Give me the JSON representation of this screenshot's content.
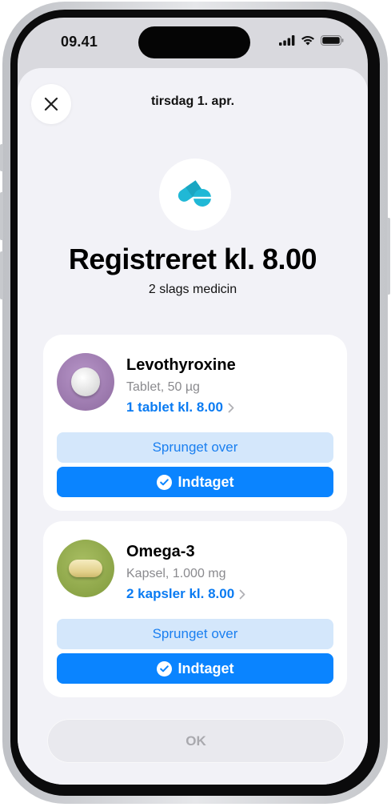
{
  "status_bar": {
    "time": "09.41",
    "icons": [
      "signal-icon",
      "wifi-icon",
      "battery-icon"
    ]
  },
  "sheet": {
    "close_icon": "close-icon",
    "date": "tirsdag 1. apr.",
    "app_icon": "pills-icon",
    "title": "Registreret kl. 8.00",
    "subtitle": "2 slags medicin"
  },
  "medications": [
    {
      "name": "Levothyroxine",
      "detail": "Tablet, 50 µg",
      "schedule": "1 tablet kl. 8.00",
      "skip_label": "Sprunget over",
      "taken_label": "Indtaget",
      "color": "#9b79ad"
    },
    {
      "name": "Omega-3",
      "detail": "Kapsel, 1.000 mg",
      "schedule": "2 kapsler kl. 8.00",
      "skip_label": "Sprunget over",
      "taken_label": "Indtaget",
      "color": "#93ab4e"
    }
  ],
  "ok_label": "OK",
  "colors": {
    "accent": "#0a84ff",
    "skip_bg": "#d4e7fb",
    "sheet_bg": "#f2f2f7",
    "app_icon": "#20b8d6"
  }
}
